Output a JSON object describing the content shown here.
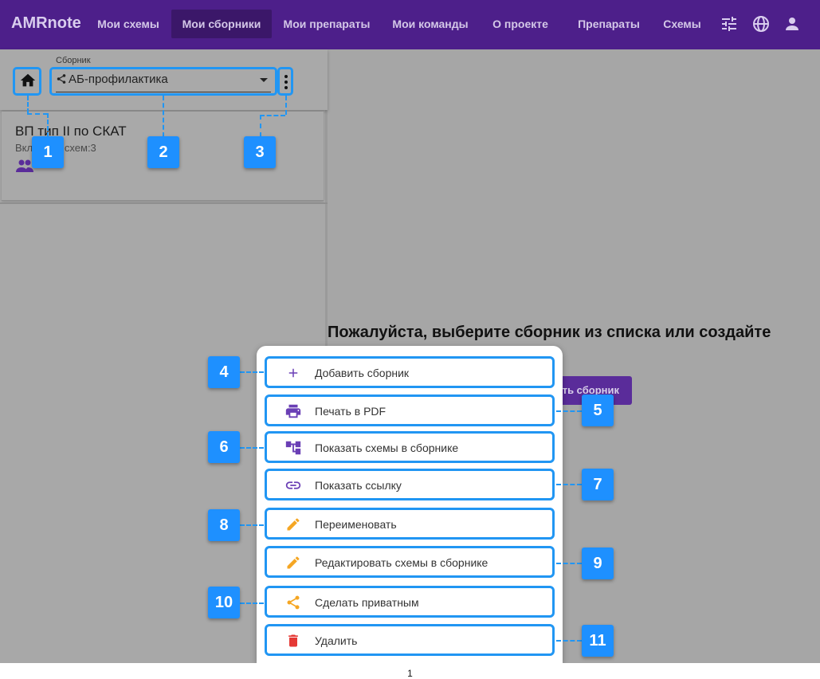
{
  "app": {
    "brand": "AMRnote"
  },
  "nav": {
    "items": [
      {
        "label": "Мои схемы"
      },
      {
        "label": "Мои сборники"
      },
      {
        "label": "Мои препараты"
      },
      {
        "label": "Мои команды"
      },
      {
        "label": "О проекте"
      },
      {
        "label": "Препараты"
      },
      {
        "label": "Схемы"
      }
    ],
    "icons": [
      "tune-icon",
      "globe-icon",
      "account-icon"
    ]
  },
  "selector": {
    "label": "Сборник",
    "value": "АБ-профилактика"
  },
  "card": {
    "title": "ВП тип II по СКАТ",
    "subtitle": "Включает схем:3"
  },
  "main": {
    "message": "Пожалуйста, выберите сборник из списка или создайте",
    "create_button": "ть сборник"
  },
  "menu": {
    "items": [
      {
        "label": "Добавить сборник",
        "icon": "plus-icon",
        "color": "#6a3fb5"
      },
      {
        "label": "Печать в PDF",
        "icon": "print-icon",
        "color": "#6a3fb5"
      },
      {
        "label": "Показать схемы в сборнике",
        "icon": "tree-icon",
        "color": "#6a3fb5"
      },
      {
        "label": "Показать ссылку",
        "icon": "link-icon",
        "color": "#6a3fb5"
      },
      {
        "label": "Переименовать",
        "icon": "pencil-icon",
        "color": "#f5a623"
      },
      {
        "label": "Редактировать схемы в сборнике",
        "icon": "pencil-icon",
        "color": "#f5a623"
      },
      {
        "label": "Сделать приватным",
        "icon": "share-icon",
        "color": "#f5a623"
      },
      {
        "label": "Удалить",
        "icon": "trash-icon",
        "color": "#e53935"
      }
    ]
  },
  "annotations": {
    "badges": [
      "1",
      "2",
      "3",
      "4",
      "5",
      "6",
      "7",
      "8",
      "9",
      "10",
      "11"
    ],
    "accent": "#1e90ff"
  },
  "footer": {
    "page_number": "1"
  }
}
